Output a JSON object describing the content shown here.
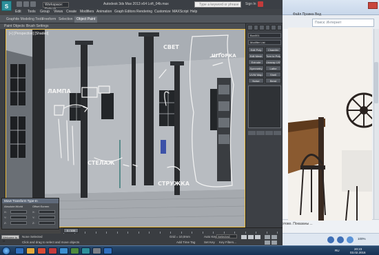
{
  "app": {
    "logo": "S",
    "workspace": "Workspace: Default",
    "title": "Autodesk 3ds Max 2013 x64    Loft_04b.max",
    "search_placeholder": "Type a keyword or phrase",
    "user": "Sign In"
  },
  "menu": [
    "Edit",
    "Tools",
    "Group",
    "Views",
    "Create",
    "Modifiers",
    "Animation",
    "Graph Editors",
    "Rendering",
    "Customize",
    "MAXScript",
    "Help"
  ],
  "ribbon": {
    "tabs": [
      "Graphite Modeling Tools",
      "Freeform",
      "Selection",
      "Object Paint"
    ],
    "active_index": 3,
    "subtabs": [
      "Paint Objects",
      "Brush Settings"
    ]
  },
  "viewport": {
    "label": "[+] [Perspective] [Shaded]",
    "annotations": {
      "svet": "СВЕТ",
      "shtorka": "ШТОРКА",
      "lampa": "ЛАМПА",
      "stelazh": "СТЕЛАЖ",
      "struzhka": "СТРУЖКА"
    }
  },
  "command_panel": {
    "object_name": "Box001",
    "modifier_list": "Modifier List",
    "buttons": [
      "Edit Poly",
      "Chamfer",
      "Edit Mesh",
      "Turn to Poly",
      "Extrude",
      "Unwrap UVW",
      "Symmetry",
      "Lathe",
      "UVW Map",
      "Shell",
      "Noise",
      "Bend"
    ]
  },
  "dialog": {
    "title": "Move Transform Type-In",
    "left_caption": "Absolute:World",
    "right_caption": "Offset:Screen",
    "axes": [
      "X:",
      "Y:",
      "Z:"
    ]
  },
  "timeline": {
    "frame": "0 / 100"
  },
  "status": {
    "mini_listener": "Welcome to M",
    "line1": "None Selected",
    "line2": "Click and drag to select and move objects",
    "grid": "Grid = 10,0mm",
    "autokey": "Auto Key",
    "selected": "Selected",
    "set_key": "Set Key",
    "key_filters": "Key Filters...",
    "add_time_tag": "Add Time Tag"
  },
  "browser": {
    "search_placeholder": "Поиск: Интернет",
    "toolbar": "Файл  Правка  Вид",
    "status": "Готово. Показаны ... ",
    "zoom": "100%"
  },
  "taskbar": {
    "lang": "RU",
    "time": "20:23",
    "date": "03.02.2016"
  },
  "colors": {
    "accent": "#2d8f9a",
    "viewport_border": "#f0c040",
    "chalk": "#f4f4f4",
    "taskbar": "#1e3c62"
  }
}
